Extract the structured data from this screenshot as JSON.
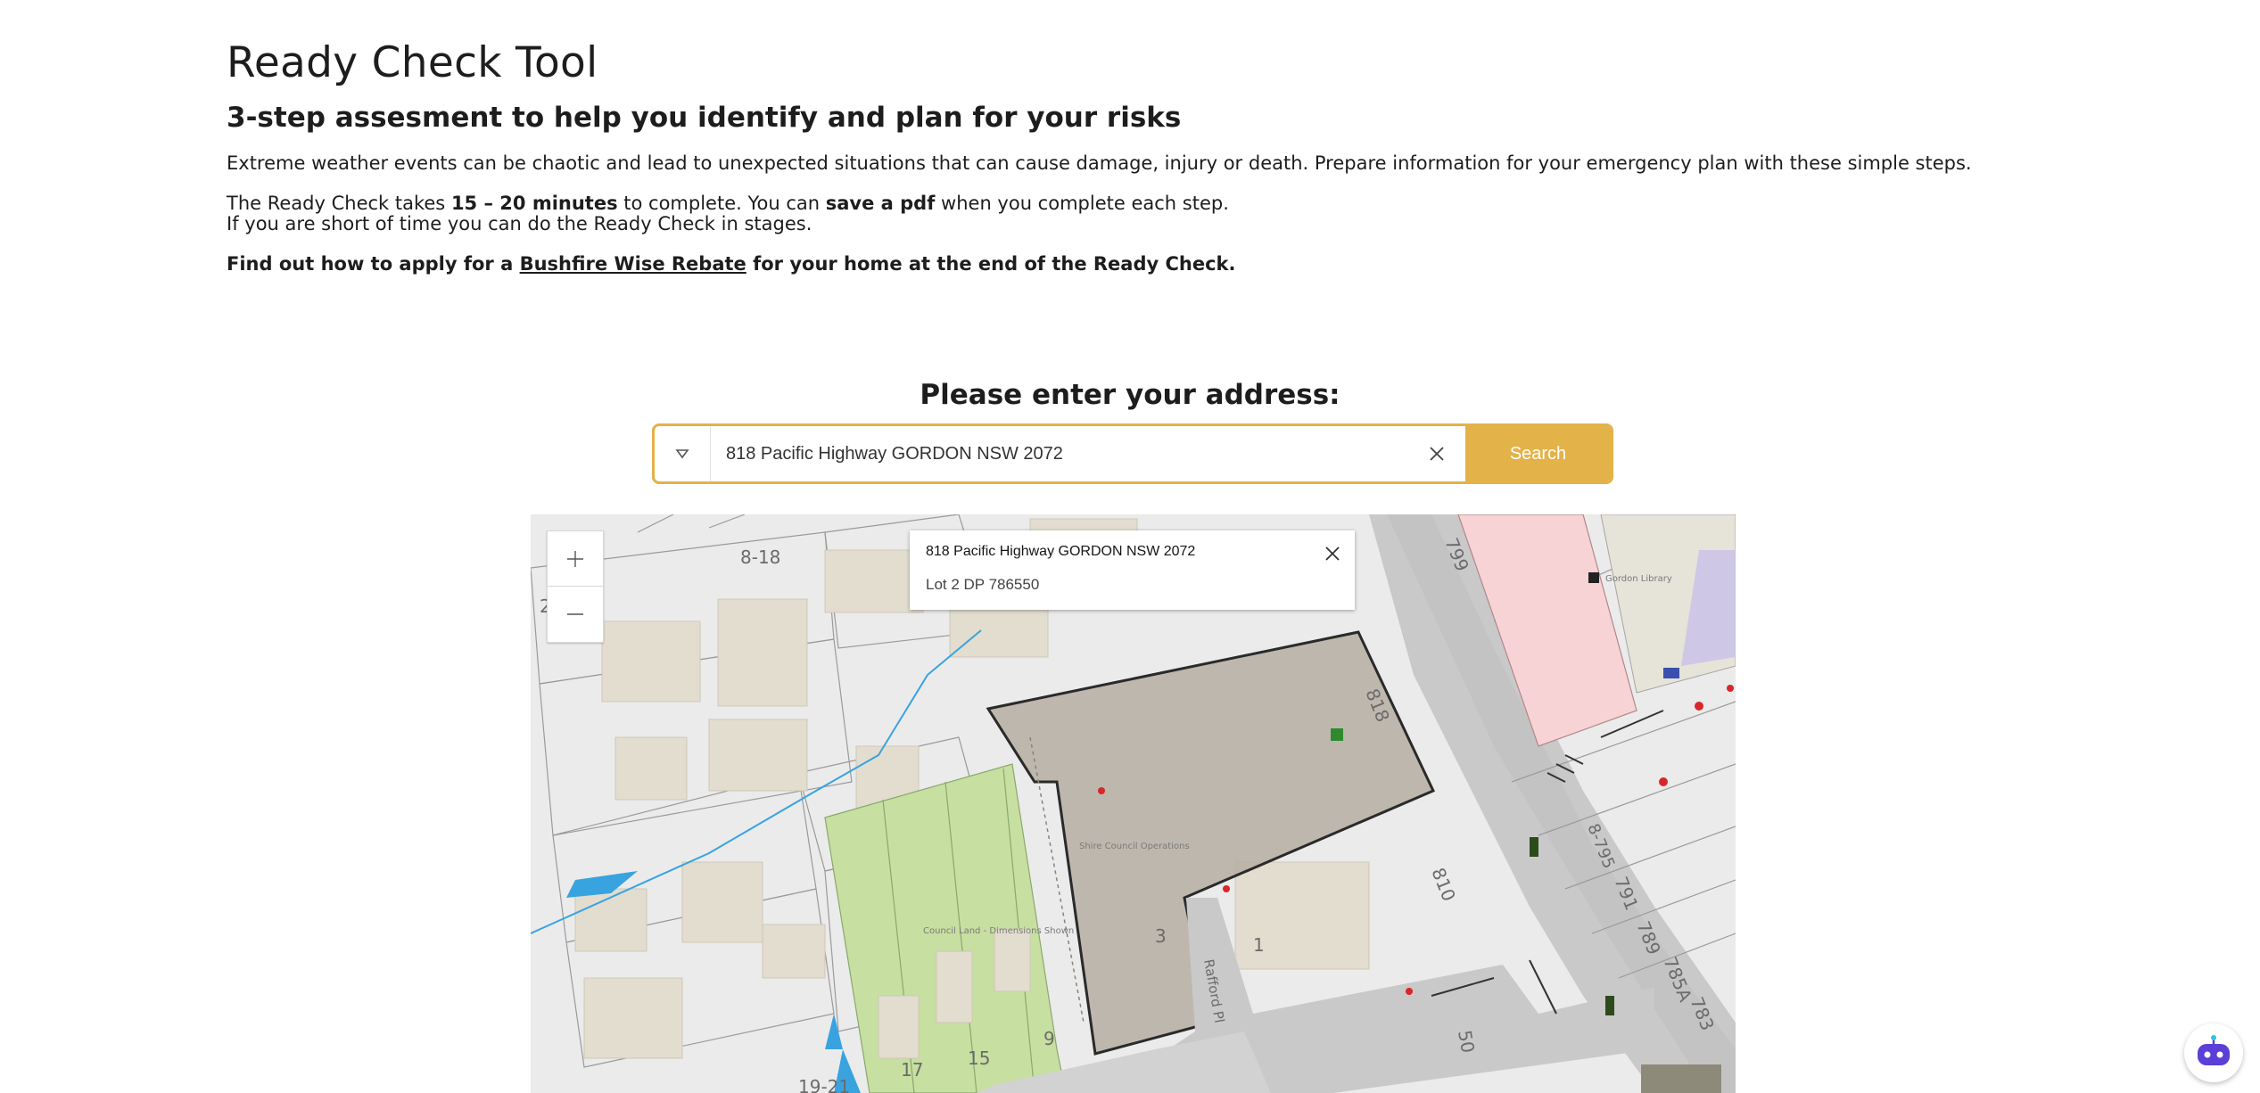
{
  "page": {
    "title": "Ready Check Tool",
    "subtitle": "3-step assesment to help you identify and plan for your risks",
    "intro": "Extreme weather events can be chaotic and lead to unexpected situations that can cause damage, injury or death. Prepare information for your emergency plan with these simple steps.",
    "time_p1": "The Ready Check takes ",
    "time_bold": "15 – 20 minutes",
    "time_p2": " to complete. You can ",
    "time_bold2": "save a pdf",
    "time_p3": " when you complete each step.",
    "time_line2": "If you are short of time you can do the Ready Check in stages.",
    "rebate_p1": "Find out how to apply for a ",
    "rebate_link": "Bushfire Wise Rebate",
    "rebate_p2": " for your home at the end of the Ready Check."
  },
  "search": {
    "heading": "Please enter your address:",
    "value": "818 Pacific Highway GORDON NSW 2072",
    "button": "Search"
  },
  "map": {
    "popup_title": "818 Pacific Highway GORDON NSW 2072",
    "popup_lot": "Lot 2 DP 786550",
    "labels": {
      "l818top": "8-18",
      "l818": "818",
      "l810": "810",
      "l799": "799",
      "l8795": "8-795",
      "l791": "791",
      "l789": "789",
      "l785a": "785A",
      "l783": "783",
      "l15": "15",
      "l17": "17",
      "l9": "9",
      "l3": "3",
      "l1": "1",
      "l50": "50",
      "l1921": "19-21",
      "l2": "2",
      "raffordpl": "Rafford Pl",
      "library": "Gordon Library",
      "council": "Council Land - Dimensions Shown",
      "carpark": "Shire Council Operations"
    }
  },
  "colors": {
    "accent": "#e3b248",
    "text": "#1d1d1d",
    "parcel": "#b6aea2",
    "green": "#c7dfa0",
    "water": "#39a3e0"
  }
}
